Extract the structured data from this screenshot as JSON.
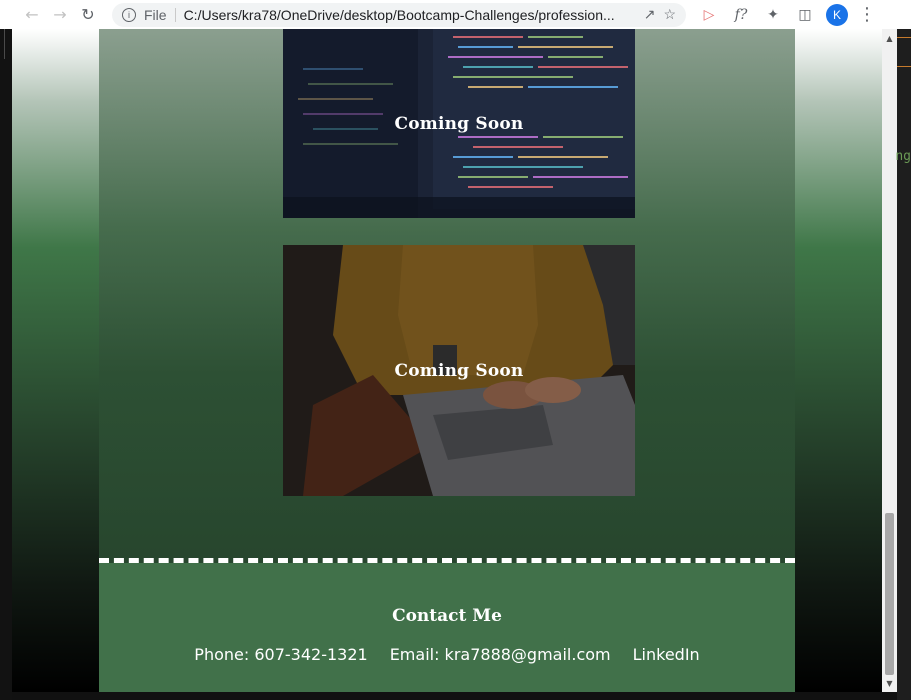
{
  "browser": {
    "file_label": "File",
    "url": "C:/Users/kra78/OneDrive/desktop/Bootcamp-Challenges/profession...",
    "profile_initial": "K"
  },
  "cards": [
    {
      "label": "Coming Soon"
    },
    {
      "label": "Coming Soon"
    }
  ],
  "footer": {
    "title": "Contact Me",
    "phone": "Phone: 607-342-1321",
    "email": "Email: kra7888@gmail.com",
    "linkedin": "LinkedIn"
  },
  "background_peek_text": "ng",
  "colors": {
    "page_green": "#3f7748",
    "footer_green": "#41714a",
    "accent_blue": "#1a73e8"
  }
}
